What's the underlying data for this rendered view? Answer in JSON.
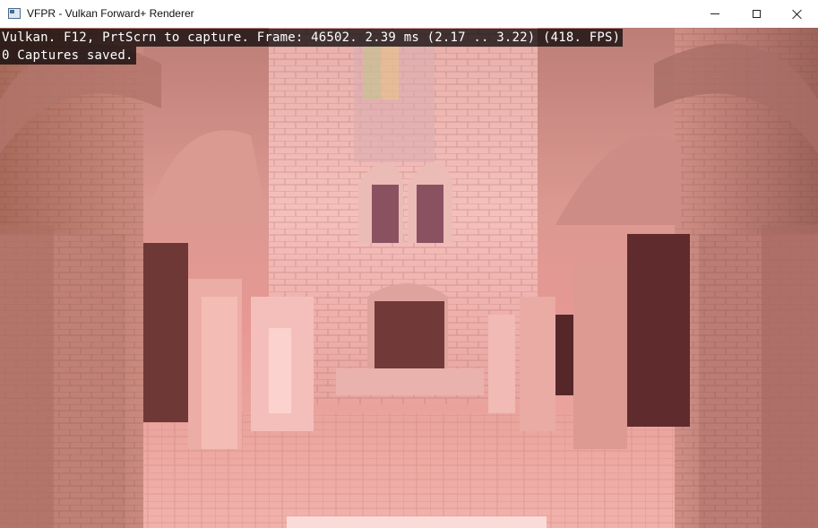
{
  "window": {
    "title": "VFPR - Vulkan Forward+ Renderer",
    "controls": {
      "minimize": "minimize-icon",
      "maximize": "maximize-icon",
      "close": "close-icon"
    }
  },
  "overlay": {
    "status_line": "Vulkan. F12, PrtScrn to capture. Frame: 46502. 2.39 ms (2.17 .. 3.22) (418. FPS)",
    "captures_line": "0 Captures saved."
  },
  "colors": {
    "overlay_bg": "#000000",
    "overlay_text": "#ffffff",
    "scene_tint": "#e59a96"
  }
}
